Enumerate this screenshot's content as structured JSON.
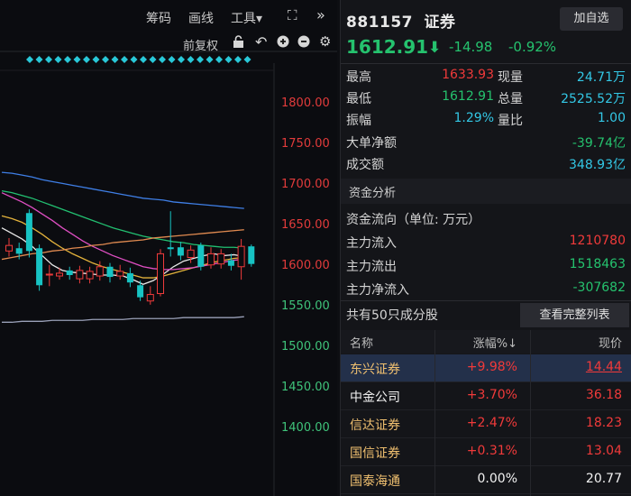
{
  "toolbar": {
    "chips": "筹码",
    "draw": "画线",
    "tools": "工具▾",
    "fuquan": "前复权"
  },
  "axis": {
    "ticks": [
      "1800.00",
      "1750.00",
      "1700.00",
      "1650.00",
      "1600.00",
      "1550.00",
      "1500.00",
      "1450.00",
      "1400.00"
    ]
  },
  "chart_data": {
    "type": "candlestick",
    "ylim": [
      1372,
      1830
    ],
    "y_ticks": [
      1800,
      1750,
      1700,
      1650,
      1600,
      1550,
      1500,
      1450,
      1400
    ],
    "candles": [
      {
        "o": 1627,
        "c": 1633,
        "h": 1641,
        "l": 1621
      },
      {
        "o": 1630,
        "c": 1624,
        "h": 1636,
        "l": 1618
      },
      {
        "o": 1668,
        "c": 1627,
        "h": 1672,
        "l": 1620
      },
      {
        "o": 1630,
        "c": 1590,
        "h": 1634,
        "l": 1584
      },
      {
        "o": 1601,
        "c": 1602,
        "h": 1612,
        "l": 1589
      },
      {
        "o": 1600,
        "c": 1603,
        "h": 1609,
        "l": 1596
      },
      {
        "o": 1606,
        "c": 1601,
        "h": 1610,
        "l": 1596
      },
      {
        "o": 1597,
        "c": 1606,
        "h": 1611,
        "l": 1592
      },
      {
        "o": 1597,
        "c": 1605,
        "h": 1610,
        "l": 1592
      },
      {
        "o": 1600,
        "c": 1610,
        "h": 1616,
        "l": 1595
      },
      {
        "o": 1610,
        "c": 1599,
        "h": 1614,
        "l": 1593
      },
      {
        "o": 1600,
        "c": 1605,
        "h": 1612,
        "l": 1596
      },
      {
        "o": 1603,
        "c": 1593,
        "h": 1609,
        "l": 1588
      },
      {
        "o": 1590,
        "c": 1577,
        "h": 1595,
        "l": 1573
      },
      {
        "o": 1573,
        "c": 1580,
        "h": 1589,
        "l": 1569
      },
      {
        "o": 1581,
        "c": 1624,
        "h": 1629,
        "l": 1578
      },
      {
        "o": 1631,
        "c": 1629,
        "h": 1670,
        "l": 1621
      },
      {
        "o": 1631,
        "c": 1622,
        "h": 1637,
        "l": 1617
      },
      {
        "o": 1620,
        "c": 1628,
        "h": 1633,
        "l": 1614
      },
      {
        "o": 1633,
        "c": 1610,
        "h": 1636,
        "l": 1606
      },
      {
        "o": 1612,
        "c": 1624,
        "h": 1631,
        "l": 1608
      },
      {
        "o": 1613,
        "c": 1624,
        "h": 1629,
        "l": 1608
      },
      {
        "o": 1617,
        "c": 1611,
        "h": 1624,
        "l": 1606
      },
      {
        "o": 1610,
        "c": 1632,
        "h": 1640,
        "l": 1596
      },
      {
        "o": 1632,
        "c": 1613,
        "h": 1634,
        "l": 1610
      }
    ],
    "ma": [
      {
        "color": "#e8e8e8",
        "values": [
          1652,
          1646,
          1640,
          1632,
          1622,
          1612,
          1606,
          1604,
          1603,
          1602,
          1601,
          1601,
          1600,
          1596,
          1591,
          1595,
          1602,
          1610,
          1616,
          1619,
          1622,
          1624,
          1622,
          1623,
          1621
        ]
      },
      {
        "color": "#e3b23c",
        "values": [
          1665,
          1662,
          1658,
          1652,
          1645,
          1637,
          1630,
          1624,
          1619,
          1614,
          1610,
          1607,
          1604,
          1601,
          1598,
          1598,
          1600,
          1603,
          1606,
          1609,
          1612,
          1615,
          1617,
          1619,
          1620
        ]
      },
      {
        "color": "#e04fc3",
        "values": [
          1690,
          1685,
          1680,
          1674,
          1667,
          1660,
          1652,
          1645,
          1638,
          1632,
          1627,
          1622,
          1618,
          1614,
          1610,
          1608,
          1607,
          1607,
          1608,
          1609,
          1611,
          1613,
          1615,
          1617,
          1618
        ]
      },
      {
        "color": "#22c071",
        "values": [
          1692,
          1690,
          1687,
          1684,
          1680,
          1676,
          1672,
          1668,
          1664,
          1660,
          1656,
          1652,
          1649,
          1646,
          1643,
          1641,
          1639,
          1637,
          1636,
          1634,
          1633,
          1632,
          1631,
          1631,
          1630
        ]
      },
      {
        "color": "#3f7fe6",
        "values": [
          1712,
          1711,
          1709,
          1707,
          1704,
          1702,
          1700,
          1698,
          1696,
          1694,
          1692,
          1690,
          1688,
          1686,
          1684,
          1683,
          1682,
          1680,
          1679,
          1678,
          1677,
          1676,
          1675,
          1674,
          1673
        ]
      },
      {
        "color": "#e08a50",
        "values": [
          1618,
          1620,
          1622,
          1624,
          1625,
          1627,
          1628,
          1630,
          1631,
          1633,
          1634,
          1636,
          1637,
          1638,
          1639,
          1641,
          1642,
          1643,
          1644,
          1645,
          1646,
          1647,
          1648,
          1649,
          1650
        ]
      },
      {
        "color": "#9aa0b8",
        "values": [
          1550,
          1550,
          1551,
          1551,
          1551,
          1552,
          1552,
          1552,
          1552,
          1553,
          1553,
          1553,
          1553,
          1554,
          1554,
          1554,
          1554,
          1554,
          1555,
          1555,
          1555,
          1555,
          1555,
          1555,
          1556
        ]
      }
    ]
  },
  "quote": {
    "code": "881157",
    "name": "证券",
    "add_label": "加自选",
    "price": "1612.91",
    "change": "-14.98",
    "change_pct": "-0.92%"
  },
  "stats": {
    "high_label": "最高",
    "high": "1633.93",
    "vol_now_label": "现量",
    "vol_now": "24.71万",
    "low_label": "最低",
    "low": "1612.91",
    "vol_total_label": "总量",
    "vol_total": "2525.52万",
    "amp_label": "振幅",
    "amp": "1.29%",
    "ratio_label": "量比",
    "ratio": "1.00",
    "bignet_label": "大单净额",
    "bignet": "-39.74亿",
    "turnover_label": "成交额",
    "turnover": "348.93亿"
  },
  "fund": {
    "title": "资金分析",
    "flow_label": "资金流向（单位: 万元）",
    "in_label": "主力流入",
    "in": "1210780",
    "out_label": "主力流出",
    "out": "1518463",
    "net_label": "主力净流入",
    "net": "-307682"
  },
  "constituents": {
    "count_label": "共有50只成分股",
    "view_all": "查看完整列表",
    "col_name": "名称",
    "col_chg": "涨幅%↓",
    "col_price": "现价",
    "rows": [
      {
        "name": "东兴证券",
        "chg": "+9.98%",
        "price": "14.44"
      },
      {
        "name": "中金公司",
        "chg": "+3.70%",
        "price": "36.18"
      },
      {
        "name": "信达证券",
        "chg": "+2.47%",
        "price": "18.23"
      },
      {
        "name": "国信证券",
        "chg": "+0.31%",
        "price": "13.04"
      },
      {
        "name": "国泰海通",
        "chg": "0.00%",
        "price": "20.77"
      }
    ]
  }
}
